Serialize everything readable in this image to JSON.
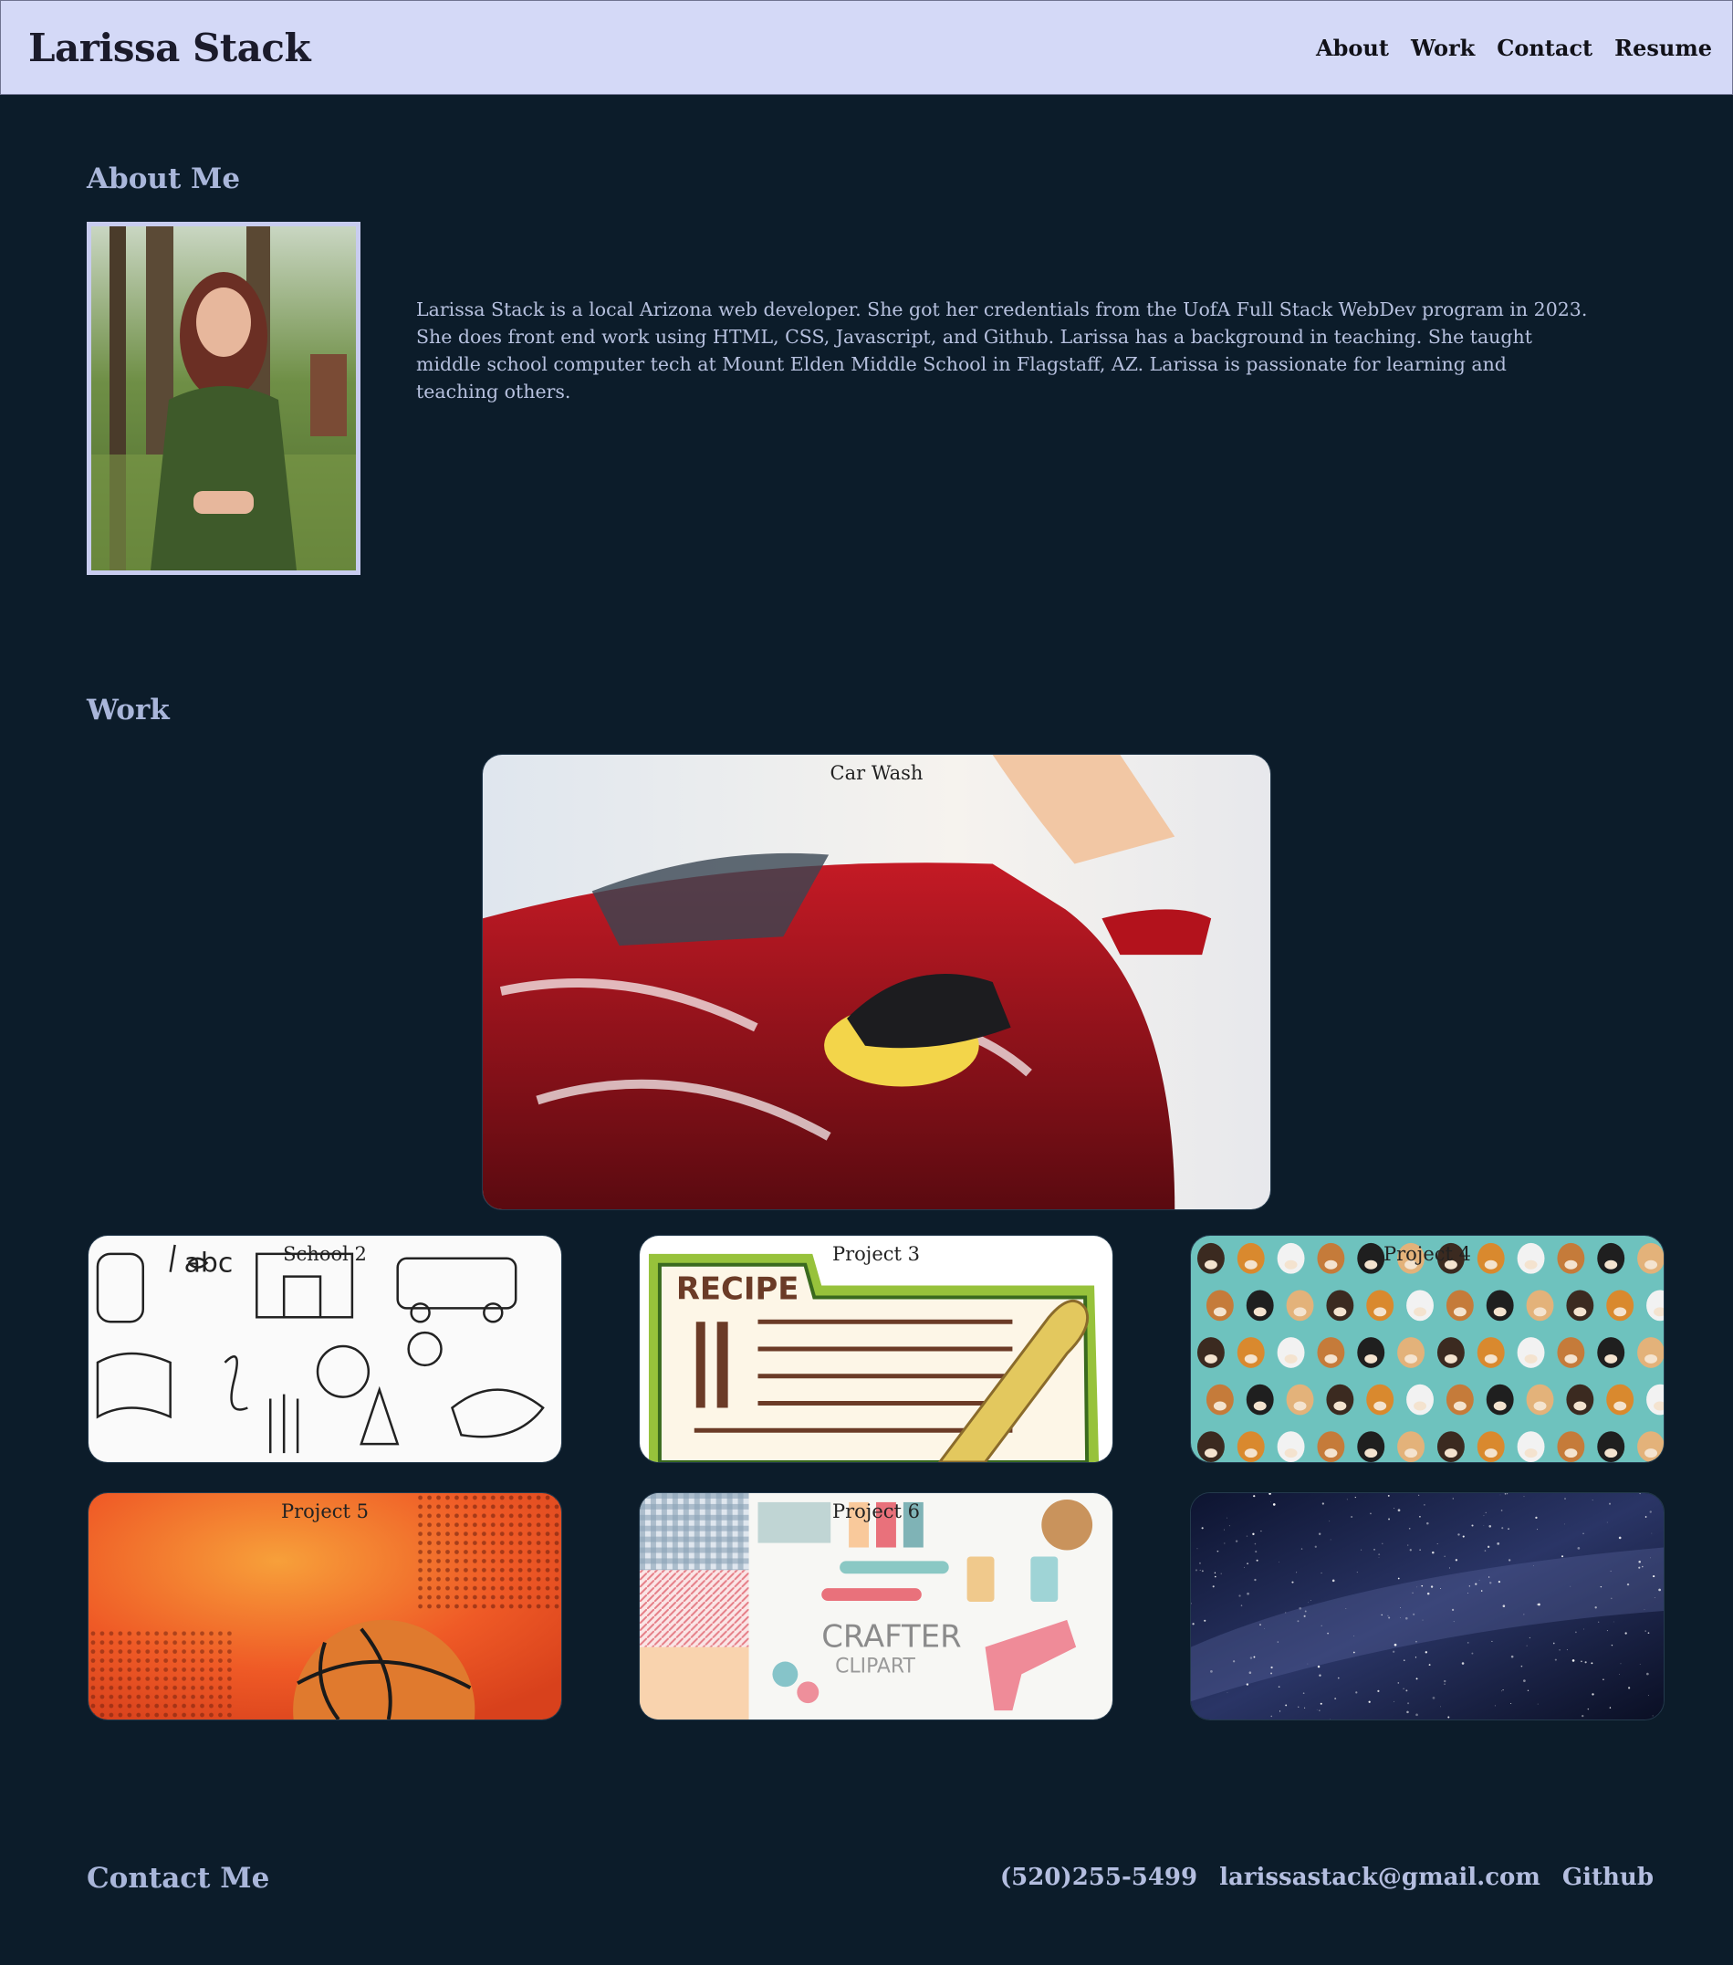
{
  "header": {
    "brand": "Larissa Stack",
    "nav": [
      "About",
      "Work",
      "Contact",
      "Resume"
    ]
  },
  "about": {
    "title": "About Me",
    "bio": "Larissa Stack is a local Arizona web developer. She got her credentials from the UofA Full Stack WebDev program in 2023. She does front end work using HTML, CSS, Javascript, and Github. Larissa has a background in teaching. She taught middle school computer tech at Mount Elden Middle School in Flagstaff, AZ. Larissa is passionate for learning and teaching others."
  },
  "work": {
    "title": "Work",
    "projects": [
      {
        "label": "Car Wash",
        "image": "red car being washed with sponge"
      },
      {
        "label": "School 2",
        "image": "school doodle pattern"
      },
      {
        "label": "Project 3",
        "image": "recipe card"
      },
      {
        "label": "Project 4",
        "image": "dog faces pattern"
      },
      {
        "label": "Project 5",
        "image": "orange basketball"
      },
      {
        "label": "Project 6",
        "image": "crafter clipart"
      },
      {
        "label": "",
        "image": "starry night sky"
      }
    ]
  },
  "contact": {
    "title": "Contact Me",
    "phone": "(520)255-5499",
    "email": "larissastack@gmail.com",
    "github": "Github"
  },
  "colors": {
    "background": "#0c1c2a",
    "header_bg": "#d4d9f7",
    "heading": "#a9b6da",
    "text": "#b6c0de"
  }
}
